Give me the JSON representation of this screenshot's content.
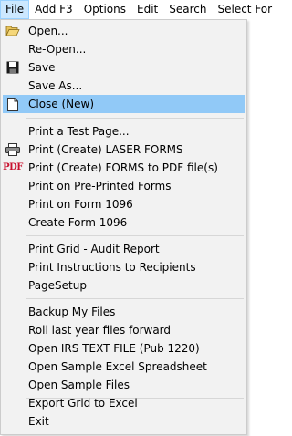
{
  "menubar": {
    "items": [
      "File",
      "Add F3",
      "Options",
      "Edit",
      "Search",
      "Select For"
    ]
  },
  "menu": {
    "group1": [
      "Open...",
      "Re-Open...",
      "Save",
      "Save As...",
      "Close (New)"
    ],
    "group2": [
      "Print a Test Page...",
      "Print (Create) LASER FORMS",
      "Print (Create) FORMS to PDF file(s)",
      "Print on Pre-Printed Forms",
      "Print on Form 1096",
      "Create Form 1096"
    ],
    "group3": [
      "Print Grid - Audit Report",
      "Print Instructions to Recipients",
      "PageSetup"
    ],
    "group4": [
      "Backup My Files",
      "Roll last year files forward",
      "Open IRS TEXT FILE (Pub 1220)",
      "Open Sample Excel Spreadsheet",
      "Open Sample Files"
    ],
    "group5": [
      "Export Grid to Excel",
      "Exit"
    ],
    "pdf_icon_text": "PDF"
  },
  "colors": {
    "highlight": "#91c9f7",
    "menubar_active": "#cce8ff",
    "menu_bg": "#f2f2f2"
  }
}
